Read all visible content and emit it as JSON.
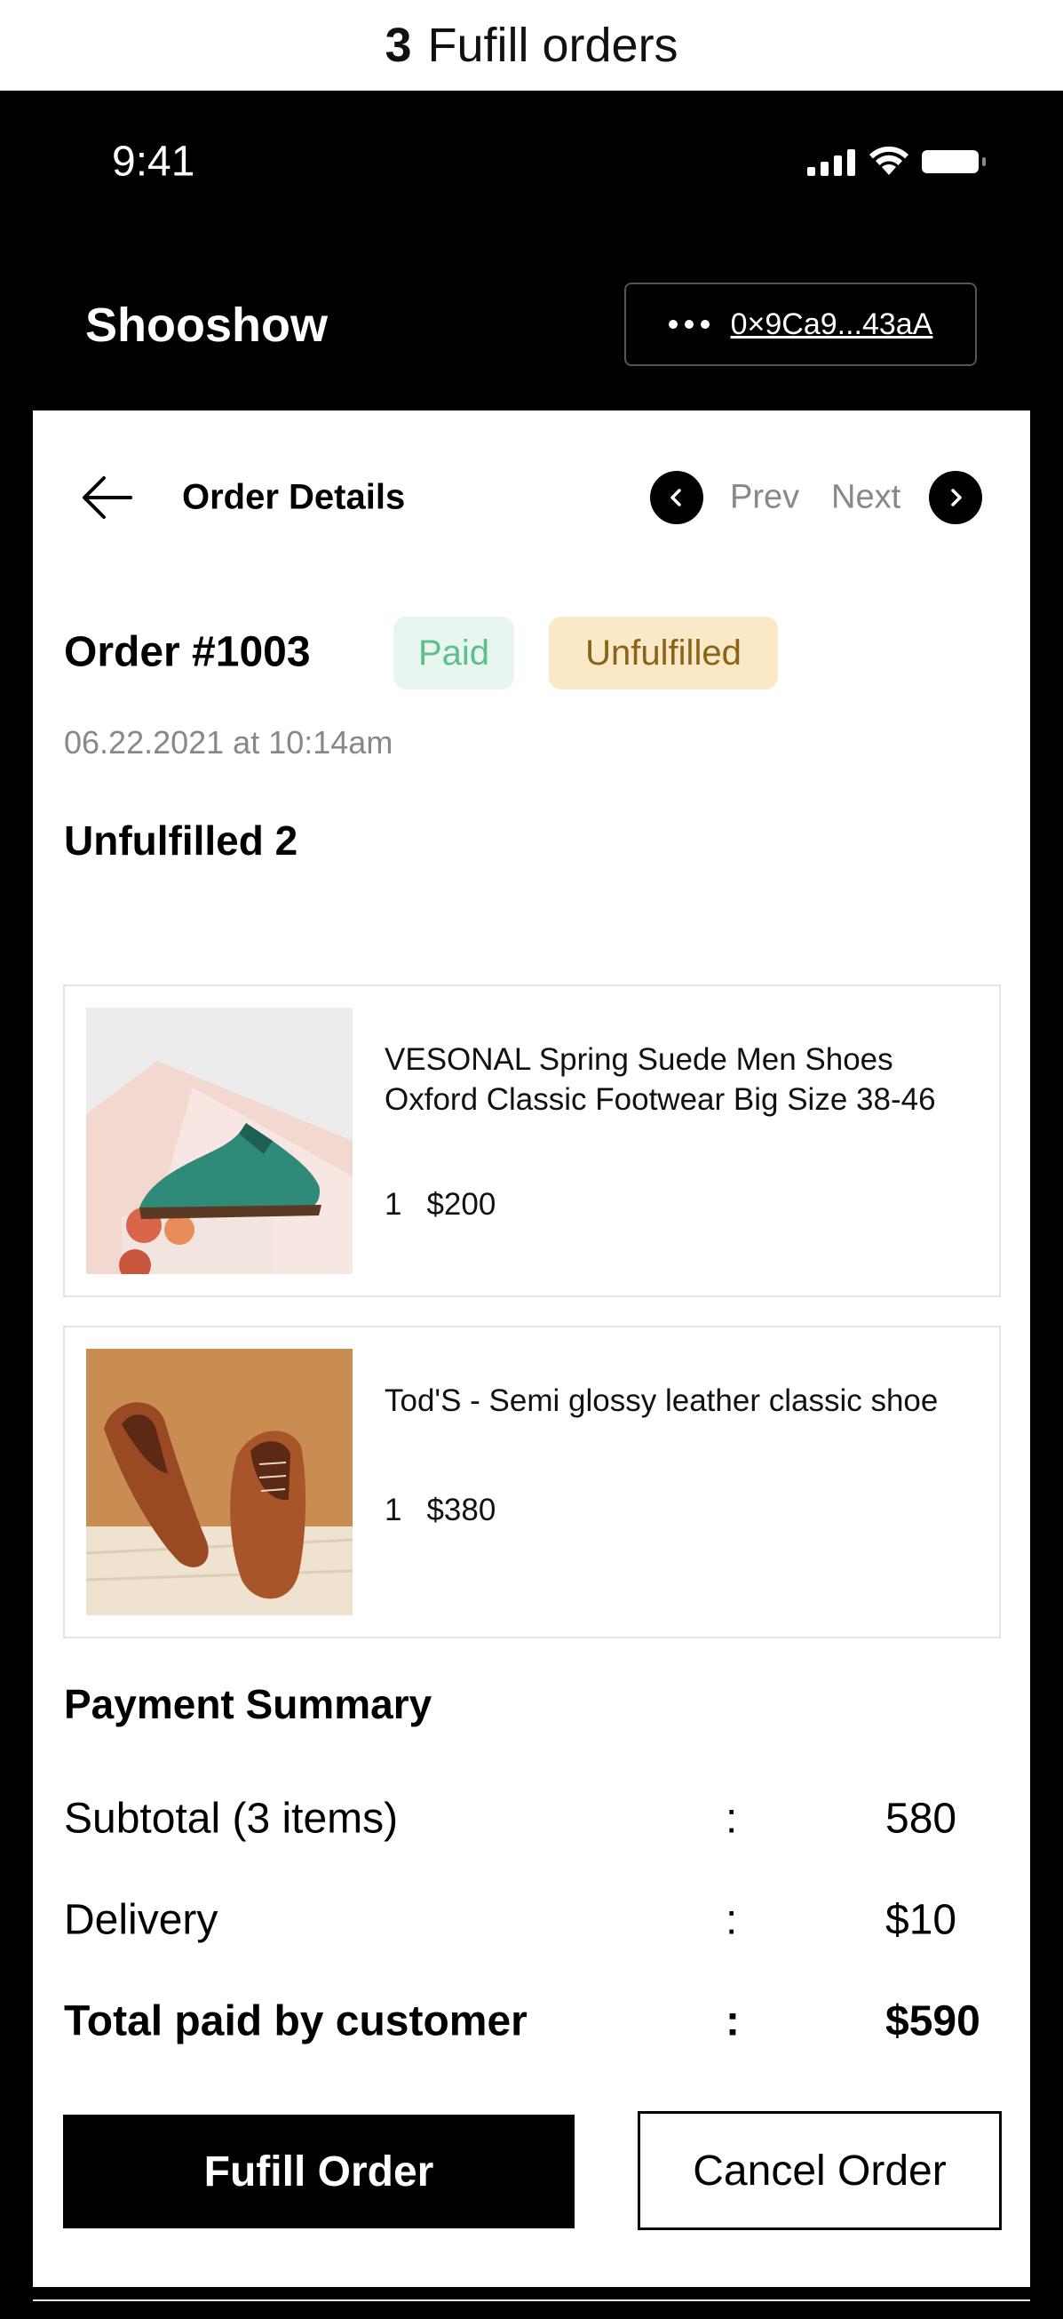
{
  "caption": {
    "step": "3",
    "text": "Fufill orders"
  },
  "status_bar": {
    "time": "9:41"
  },
  "header": {
    "brand": "Shooshow",
    "wallet_address": "0×9Ca9...43aA"
  },
  "nav": {
    "title": "Order Details",
    "prev_label": "Prev",
    "next_label": "Next"
  },
  "order": {
    "title": "Order #1003",
    "badges": {
      "paid": "Paid",
      "unfulfilled": "Unfulfilled"
    },
    "date": "06.22.2021 at 10:14am",
    "colors": {
      "paid_bg": "#e7f6ee",
      "paid_text": "#5cc08a",
      "unfulfilled_bg": "#fbe8c6",
      "unfulfilled_text": "#8a6317"
    }
  },
  "unfulfilled": {
    "heading": "Unfulfilled 2",
    "items": [
      {
        "name": "VESONAL Spring Suede Men Shoes Oxford Classic Footwear Big Size 38-46",
        "qty": "1",
        "price": "$200",
        "image": "green-suede-oxford-shoe"
      },
      {
        "name": "Tod'S - Semi glossy leather classic shoe",
        "qty": "1",
        "price": "$380",
        "image": "brown-leather-shoes-pair"
      }
    ]
  },
  "payment": {
    "heading": "Payment Summary",
    "rows": [
      {
        "label": "Subtotal (3 items)",
        "colon": ":",
        "value": "580"
      },
      {
        "label": "Delivery",
        "colon": ":",
        "value": "$10"
      },
      {
        "label": "Total paid by customer",
        "colon": ":",
        "value": "$590"
      }
    ]
  },
  "actions": {
    "fulfill_label": "Fufill Order",
    "cancel_label": "Cancel Order"
  }
}
